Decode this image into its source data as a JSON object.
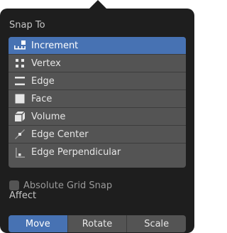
{
  "popover": {
    "snap_to_title": "Snap To",
    "snap_items": [
      {
        "label": "Increment",
        "icon": "increment-icon",
        "active": true
      },
      {
        "label": "Vertex",
        "icon": "vertex-icon",
        "active": false
      },
      {
        "label": "Edge",
        "icon": "edge-icon",
        "active": false
      },
      {
        "label": "Face",
        "icon": "face-icon",
        "active": false
      },
      {
        "label": "Volume",
        "icon": "volume-icon",
        "active": false
      },
      {
        "label": "Edge Center",
        "icon": "edge-center-icon",
        "active": false
      },
      {
        "label": "Edge Perpendicular",
        "icon": "edge-perpendicular-icon",
        "active": false
      }
    ],
    "absolute_grid_snap": {
      "label": "Absolute Grid Snap",
      "checked": false
    },
    "affect_title": "Affect",
    "affect_buttons": [
      {
        "label": "Move",
        "active": true
      },
      {
        "label": "Rotate",
        "active": false
      },
      {
        "label": "Scale",
        "active": false
      }
    ]
  },
  "colors": {
    "panel_bg": "#1e1e1e",
    "item_bg": "#545454",
    "accent": "#4772b3",
    "text": "#e6e6e6",
    "muted_text": "#9a9a9a"
  }
}
